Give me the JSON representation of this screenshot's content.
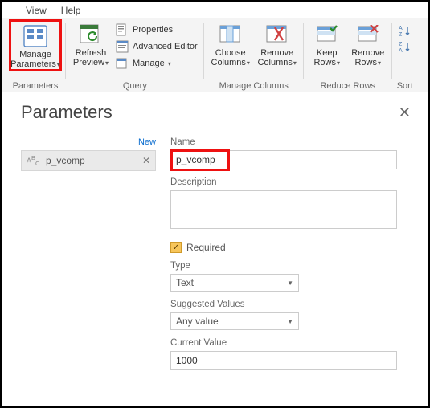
{
  "menubar": {
    "view": "View",
    "help": "Help"
  },
  "ribbon": {
    "parameters": {
      "label": "Parameters",
      "manage": "Manage\nParameters"
    },
    "query": {
      "label": "Query",
      "refresh": "Refresh\nPreview",
      "properties": "Properties",
      "advanced_editor": "Advanced Editor",
      "manage": "Manage"
    },
    "manage_columns": {
      "label": "Manage Columns",
      "choose": "Choose\nColumns",
      "remove": "Remove\nColumns"
    },
    "reduce_rows": {
      "label": "Reduce Rows",
      "keep": "Keep\nRows",
      "remove": "Remove\nRows"
    },
    "sort": {
      "label": "Sort"
    }
  },
  "panel": {
    "title": "Parameters",
    "new_link": "New",
    "list": {
      "items": [
        {
          "name": "p_vcomp",
          "type_icon": "ABC"
        }
      ]
    },
    "form": {
      "name_label": "Name",
      "name_value": "p_vcomp",
      "description_label": "Description",
      "description_value": "",
      "required_label": "Required",
      "required_checked": true,
      "type_label": "Type",
      "type_value": "Text",
      "suggested_label": "Suggested Values",
      "suggested_value": "Any value",
      "current_label": "Current Value",
      "current_value": "1000"
    }
  }
}
